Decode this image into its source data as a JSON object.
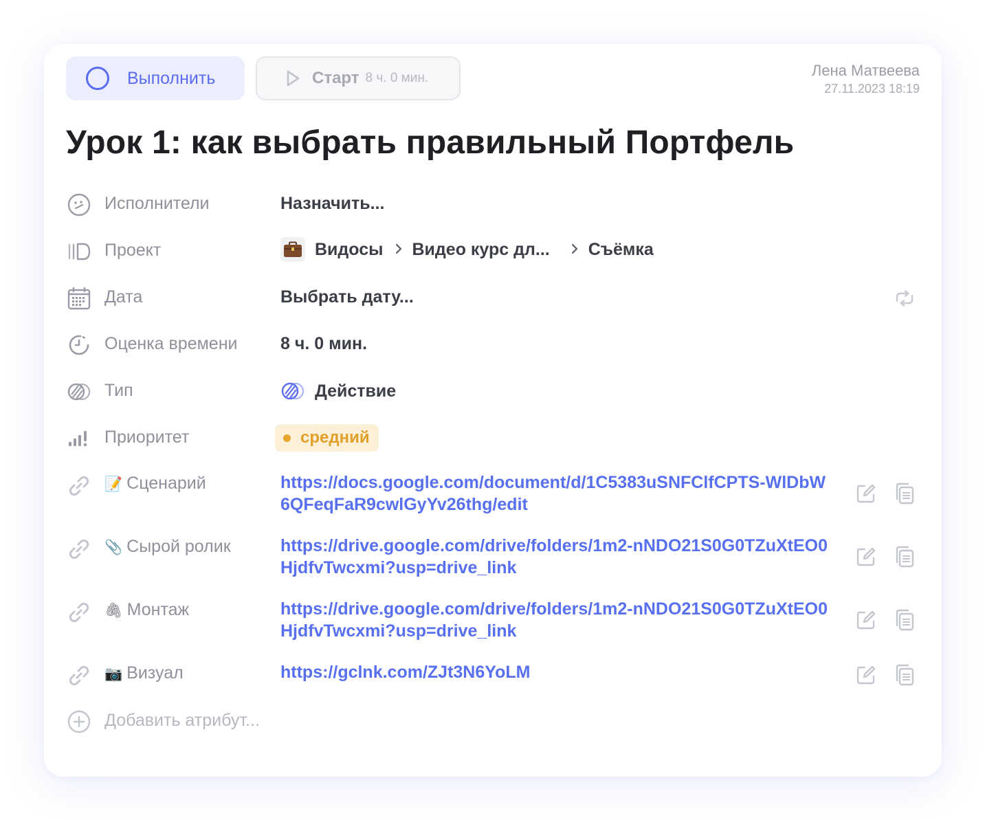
{
  "header": {
    "done_label": "Выполнить",
    "start_label": "Старт",
    "start_duration": "8 ч. 0 мин.",
    "author": "Лена Матвеева",
    "created": "27.11.2023 18:19"
  },
  "title": "Урок 1: как выбрать правильный Портфель",
  "attributes": {
    "assignees": {
      "label": "Исполнители",
      "value": "Назначить..."
    },
    "project": {
      "label": "Проект",
      "crumbs": [
        "Видосы",
        "Видео курс дл...",
        "Съёмка"
      ]
    },
    "date": {
      "label": "Дата",
      "value": "Выбрать дату..."
    },
    "estimate": {
      "label": "Оценка времени",
      "value": "8 ч. 0 мин."
    },
    "type": {
      "label": "Тип",
      "value": "Действие"
    },
    "priority": {
      "label": "Приоритет",
      "value": "средний"
    }
  },
  "links": [
    {
      "emoji": "📝",
      "label": "Сценарий",
      "url": "https://docs.google.com/document/d/1C5383uSNFClfCPTS-WlDbW6QFeqFaR9cwlGyYv26thg/edit"
    },
    {
      "emoji": "📎",
      "label": "Сырой ролик",
      "url": "https://drive.google.com/drive/folders/1m2-nNDO21S0G0TZuXtEO0HjdfvTwcxmi?usp=drive_link"
    },
    {
      "emoji": "🖇",
      "label": "Монтаж",
      "url": "https://drive.google.com/drive/folders/1m2-nNDO21S0G0TZuXtEO0HjdfvTwcxmi?usp=drive_link"
    },
    {
      "emoji": "📷",
      "label": "Визуал",
      "url": "https://gclnk.com/ZJt3N6YoLM"
    }
  ],
  "add_attribute": "Добавить атрибут...",
  "colors": {
    "accent": "#5b6cf0",
    "link": "#5870ee",
    "priority": "#e6a72c"
  },
  "icons": [
    "circle-check-icon",
    "play-icon",
    "face-icon",
    "board-icon",
    "calendar-icon",
    "timer-icon",
    "type-icon",
    "bars-icon",
    "repeat-icon",
    "link-icon",
    "edit-icon",
    "copy-icon",
    "plus-circle-icon",
    "briefcase-icon"
  ]
}
